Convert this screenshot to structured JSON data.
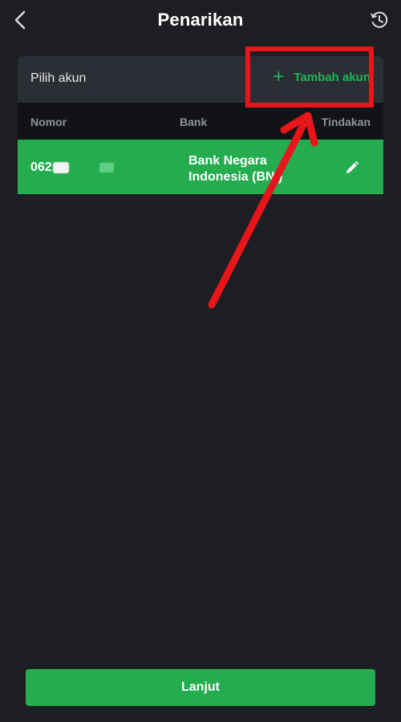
{
  "header": {
    "title": "Penarikan",
    "back_icon": "chevron-left-icon",
    "history_icon": "history-icon"
  },
  "account_card": {
    "label": "Pilih akun",
    "add_icon": "plus-icon",
    "add_label": "Tambah akun",
    "columns": [
      "Nomor",
      "Bank",
      "Tindakan"
    ],
    "rows": [
      {
        "number_visible": "062",
        "bank_line1": "Bank Negara",
        "bank_line2": "Indonesia (BNI)",
        "action_icon": "pencil-icon"
      }
    ]
  },
  "footer": {
    "continue_label": "Lanjut"
  },
  "colors": {
    "background": "#1c1e22",
    "accent_green": "#24ac4f",
    "annotation_red": "#e8151b"
  }
}
